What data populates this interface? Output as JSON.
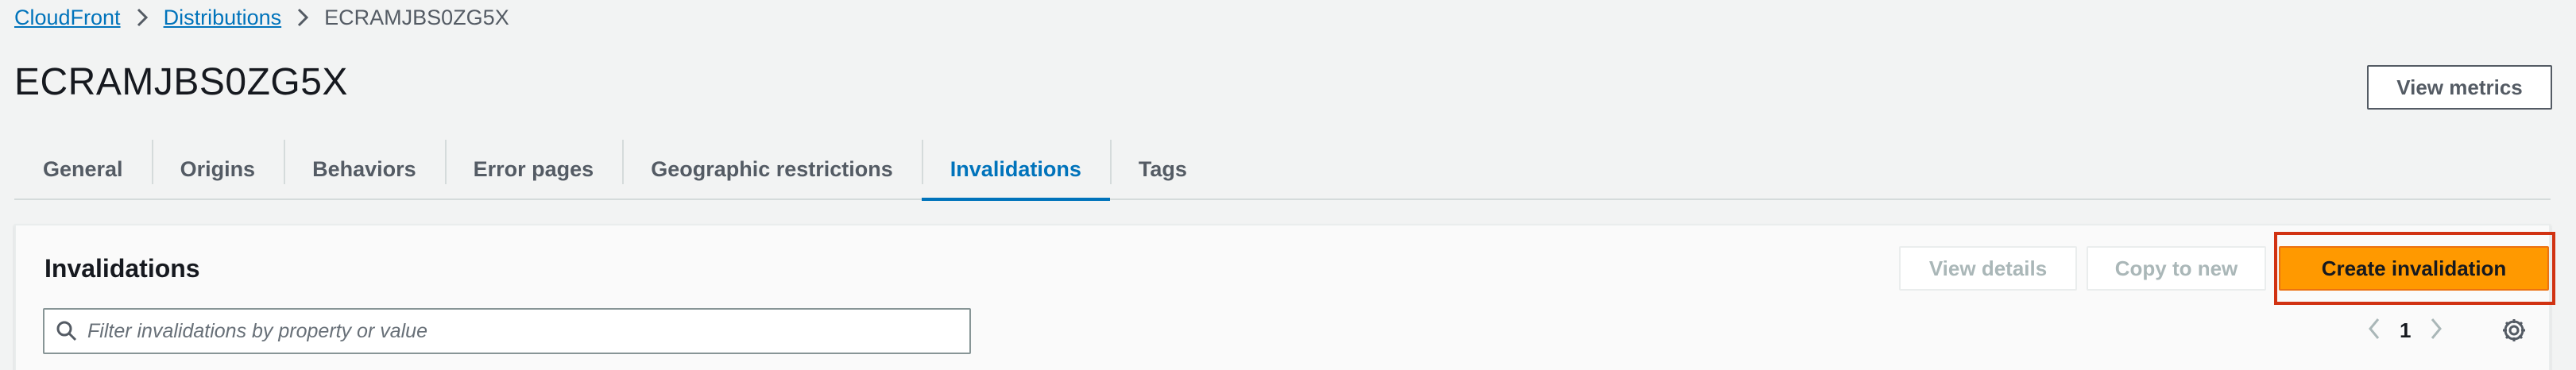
{
  "breadcrumb": {
    "items": [
      "CloudFront",
      "Distributions"
    ],
    "current": "ECRAMJBS0ZG5X"
  },
  "page": {
    "title": "ECRAMJBS0ZG5X",
    "view_metrics_label": "View metrics"
  },
  "tabs": [
    {
      "label": "General",
      "active": false
    },
    {
      "label": "Origins",
      "active": false
    },
    {
      "label": "Behaviors",
      "active": false
    },
    {
      "label": "Error pages",
      "active": false
    },
    {
      "label": "Geographic restrictions",
      "active": false
    },
    {
      "label": "Invalidations",
      "active": true
    },
    {
      "label": "Tags",
      "active": false
    }
  ],
  "invalidations": {
    "title": "Invalidations",
    "view_details_label": "View details",
    "copy_to_new_label": "Copy to new",
    "create_label": "Create invalidation",
    "search_placeholder": "Filter invalidations by property or value",
    "page_number": "1"
  },
  "colors": {
    "link": "#0073bb",
    "primary": "#ff9900",
    "highlight": "#d13212"
  },
  "icons": [
    "chevron-right-icon",
    "search-icon",
    "chevron-left-icon",
    "gear-icon"
  ]
}
